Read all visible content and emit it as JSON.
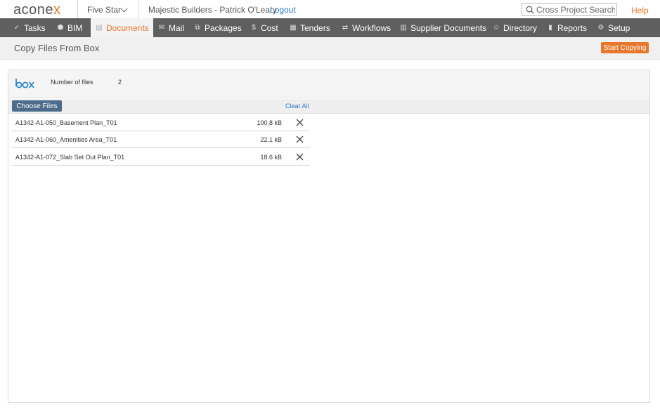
{
  "header": {
    "logo_text_main": "acone",
    "logo_text_accent": "x",
    "project_name": "Five Star",
    "user": "Majestic Builders - Patrick O'Leary",
    "logout_label": "Logout",
    "search_placeholder": "Cross Project Search",
    "help_label": "Help"
  },
  "nav": {
    "items": [
      {
        "label": "Tasks",
        "icon": "check-icon"
      },
      {
        "label": "BIM",
        "icon": "cube-icon"
      },
      {
        "label": "Documents",
        "icon": "document-icon",
        "active": true
      },
      {
        "label": "Mail",
        "icon": "envelope-icon"
      },
      {
        "label": "Packages",
        "icon": "packages-icon"
      },
      {
        "label": "Cost",
        "icon": "dollar-icon"
      },
      {
        "label": "Tenders",
        "icon": "tender-icon"
      },
      {
        "label": "Workflows",
        "icon": "workflow-icon"
      },
      {
        "label": "Supplier Documents",
        "icon": "building-icon"
      },
      {
        "label": "Directory",
        "icon": "people-icon"
      },
      {
        "label": "Reports",
        "icon": "bar-chart-icon"
      },
      {
        "label": "Setup",
        "icon": "gear-icon"
      }
    ]
  },
  "page": {
    "title": "Copy Files From Box",
    "start_button": "Start Copying"
  },
  "panel": {
    "brand": "box",
    "number_of_files_label": "Number of files",
    "number_of_files_value": "2",
    "choose_files_label": "Choose Files",
    "clear_all_label": "Clear All",
    "files": [
      {
        "name": "A1342-A1-050_Basement Plan_T01",
        "size": "100.8 kB"
      },
      {
        "name": "A1342-A1-060_Amenities Area_T01",
        "size": "22.1 kB"
      },
      {
        "name": "A1342-A1-072_Slab Set Out Plan_T01",
        "size": "18.6 kB"
      }
    ]
  },
  "colors": {
    "accent": "#e8762b",
    "nav_bg": "#5f5f5f",
    "link": "#2b79c2",
    "box_blue": "#1a7ed4",
    "choose_btn": "#4d6b8a"
  }
}
